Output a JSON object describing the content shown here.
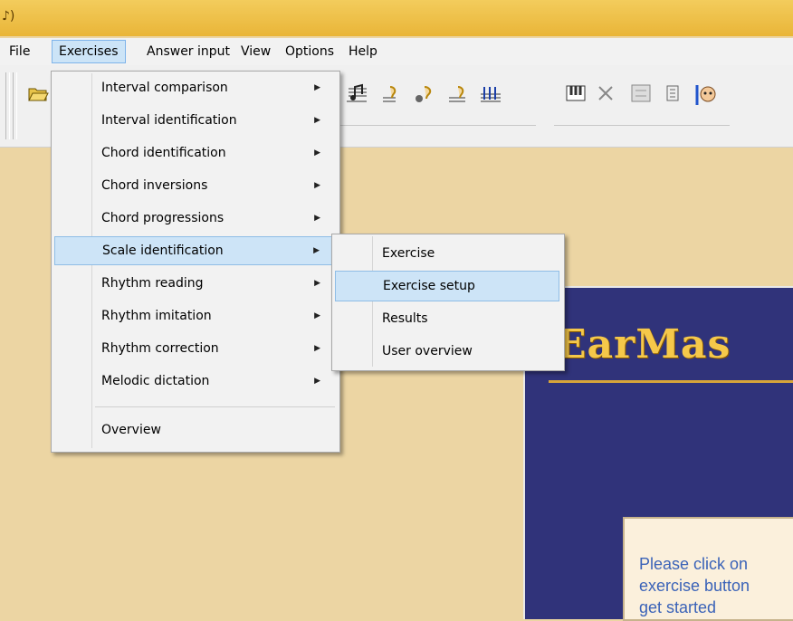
{
  "menubar": {
    "items": [
      "File",
      "Exercises",
      "Answer input",
      "View",
      "Options",
      "Help"
    ]
  },
  "exercises_menu": {
    "items": [
      {
        "label": "Interval comparison"
      },
      {
        "label": "Interval identification"
      },
      {
        "label": "Chord identification"
      },
      {
        "label": "Chord inversions"
      },
      {
        "label": "Chord progressions"
      },
      {
        "label": "Scale identification"
      },
      {
        "label": "Rhythm reading"
      },
      {
        "label": "Rhythm imitation"
      },
      {
        "label": "Rhythm correction"
      },
      {
        "label": "Melodic dictation"
      }
    ],
    "overview": "Overview",
    "highlighted": "Scale identification"
  },
  "submenu": {
    "items": [
      "Exercise",
      "Exercise setup",
      "Results",
      "User overview"
    ],
    "highlighted": "Exercise setup"
  },
  "logo_text": "EarMas",
  "message": "Please click on\nexercise button\nget started",
  "toolbar_icons": [
    "open-icon",
    "note-icon",
    "ear-hand-icon",
    "ear-icon",
    "ear-note-icon",
    "staff-icon",
    "piano-icon",
    "tools-icon",
    "percent-icon",
    "page-icon",
    "teacher-icon"
  ]
}
